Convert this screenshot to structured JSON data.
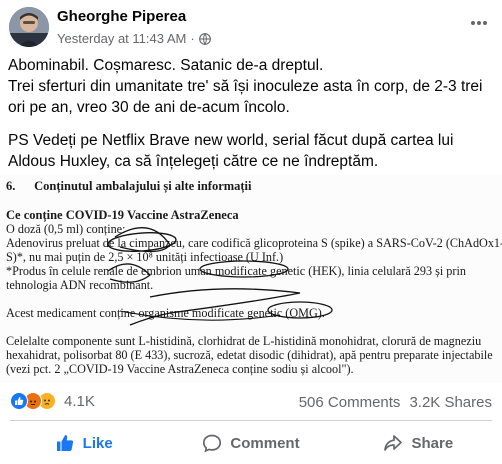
{
  "post": {
    "author": "Gheorghe Piperea",
    "timestamp": "Yesterday at 11:43 AM",
    "separator": "·",
    "privacy_icon": "globe-icon",
    "more_icon": "more-options-icon",
    "paragraphs": [
      "Abominabil. Coșmaresc. Satanic de-a dreptul.\nTrei sferturi din umanitate tre' să își inoculeze asta în corp, de 2-3 trei ori pe an, vreo 30 de ani de-acum încolo.",
      "PS Vedeți pe Netflix Brave new world, serial făcut după cartea lui Aldous Huxley, ca să înțelegeți către ce ne îndreptăm."
    ]
  },
  "document": {
    "section_number": "6.",
    "section_title": "Conținutul ambalajului și alte informații",
    "heading": "Ce conține COVID-19 Vaccine AstraZeneca",
    "lines": [
      "O doză (0,5 ml) conține:",
      "Adenovirus preluat de la cimpanzeu, care codifică glicoproteina S (spike) a SARS-CoV-2 (ChAdOx1-",
      "S)*, nu mai puțin de 2,5 × 10⁸ unități infectioase (U Inf.)",
      "*Produs în celule renale de embrion uman modificate genetic (HEK), linia celulară 293 și prin",
      "tehnologia ADN recombinant.",
      "Acest medicament conține organisme modificate genetic (OMG).",
      "Celelalte componente sunt L-histidină, clorhidrat de L-histidină monohidrat, clorură de magneziu",
      "hexahidrat, polisorbat 80 (E 433), sucroză, edetat disodic (dihidrat), apă pentru preparate injectabile",
      "(vezi pct. 2 „COVID-19 Vaccine AstraZeneca conține sodiu și alcool\")."
    ]
  },
  "stats": {
    "reactions": [
      "like-icon",
      "angry-icon",
      "sad-icon"
    ],
    "reaction_count": "4.1K",
    "comments": "506 Comments",
    "shares": "3.2K Shares"
  },
  "actions": {
    "like": "Like",
    "comment": "Comment",
    "share": "Share"
  },
  "colors": {
    "like_blue": "#1877f2",
    "secondary_text": "#65676b",
    "divider": "#ced0d4"
  }
}
